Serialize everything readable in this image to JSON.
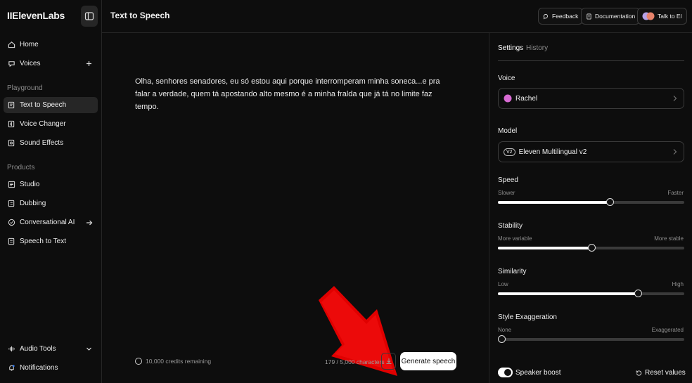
{
  "sidebar": {
    "logo": "IIElevenLabs",
    "nav_top": [
      {
        "label": "Home",
        "icon": "home-icon"
      },
      {
        "label": "Voices",
        "icon": "voices-icon"
      }
    ],
    "section_playground": "Playground",
    "playground": [
      {
        "label": "Text to Speech",
        "icon": "text-to-speech-icon",
        "active": true
      },
      {
        "label": "Voice Changer",
        "icon": "voice-changer-icon"
      },
      {
        "label": "Sound Effects",
        "icon": "sound-effects-icon"
      }
    ],
    "section_products": "Products",
    "products": [
      {
        "label": "Studio",
        "icon": "studio-icon"
      },
      {
        "label": "Dubbing",
        "icon": "dubbing-icon"
      },
      {
        "label": "Conversational AI",
        "icon": "conversational-ai-icon"
      },
      {
        "label": "Speech to Text",
        "icon": "speech-to-text-icon"
      }
    ],
    "bottom": [
      {
        "label": "Audio Tools",
        "icon": "audio-tools-icon"
      },
      {
        "label": "Notifications",
        "icon": "bell-icon"
      }
    ]
  },
  "header": {
    "title": "Text to Speech",
    "feedback": "Feedback",
    "documentation": "Documentation",
    "talk": "Talk to El"
  },
  "main": {
    "text": "Olha, senhores senadores, eu só estou aqui porque interromperam minha soneca...e pra falar a verdade, quem tá apostando alto mesmo é a minha fralda que já tá no limite faz tempo.",
    "credits": "10,000 credits remaining",
    "char_count": "179 / 5,000 characters",
    "generate": "Generate speech"
  },
  "settings": {
    "tabs": [
      "Settings",
      "History"
    ],
    "voice_label": "Voice",
    "voice_value": "Rachel",
    "model_label": "Model",
    "model_badge": "V2",
    "model_value": "Eleven Multilingual v2",
    "sliders": [
      {
        "label": "Speed",
        "min_label": "Slower",
        "max_label": "Faster",
        "value": 0.6
      },
      {
        "label": "Stability",
        "min_label": "More variable",
        "max_label": "More stable",
        "value": 0.5
      },
      {
        "label": "Similarity",
        "min_label": "Low",
        "max_label": "High",
        "value": 0.75
      },
      {
        "label": "Style Exaggeration",
        "min_label": "None",
        "max_label": "Exaggerated",
        "value": 0.0
      }
    ],
    "speaker_boost": "Speaker boost",
    "speaker_boost_on": true,
    "reset": "Reset values"
  },
  "colors": {
    "background": "#0d0d0d",
    "panel_border": "#262626",
    "accent_arrow": "#e00000",
    "voice_avatar": "#d86bd3"
  }
}
